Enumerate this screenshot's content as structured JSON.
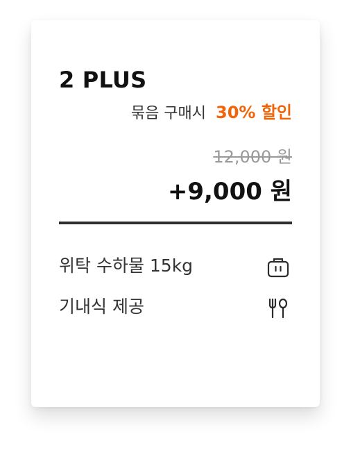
{
  "card": {
    "title": "2 PLUS",
    "promo": {
      "text": "묶음 구매시",
      "discount": "30% 할인",
      "accent_color": "#f0640a"
    },
    "price": {
      "original": "12,000 원",
      "final": "+9,000 원"
    },
    "features": [
      {
        "label": "위탁 수하물 15kg",
        "icon": "luggage-icon"
      },
      {
        "label": "기내식 제공",
        "icon": "utensils-icon"
      }
    ]
  }
}
